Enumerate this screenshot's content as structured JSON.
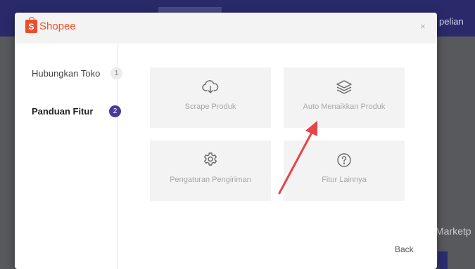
{
  "background": {
    "topbar_link": "pelian",
    "marketplace_text": "Marketp"
  },
  "modal": {
    "logo_text": "Shopee",
    "logo_letter": "S",
    "close_glyph": "×",
    "steps": [
      {
        "label": "Hubungkan Toko",
        "number": "1",
        "active": false
      },
      {
        "label": "Panduan Fitur",
        "number": "2",
        "active": true
      }
    ],
    "tiles": [
      {
        "label": "Scrape Produk",
        "icon": "cloud-download-icon"
      },
      {
        "label": "Auto Menaikkan Produk",
        "icon": "layers-icon"
      },
      {
        "label": "Pengaturan Pengiriman",
        "icon": "gear-icon"
      },
      {
        "label": "Fitur Lainnya",
        "icon": "question-circle-icon"
      }
    ],
    "back_label": "Back"
  },
  "colors": {
    "brand": "#ee4d2d",
    "accent": "#4a3a9c",
    "annotation_arrow": "#e8434a"
  }
}
